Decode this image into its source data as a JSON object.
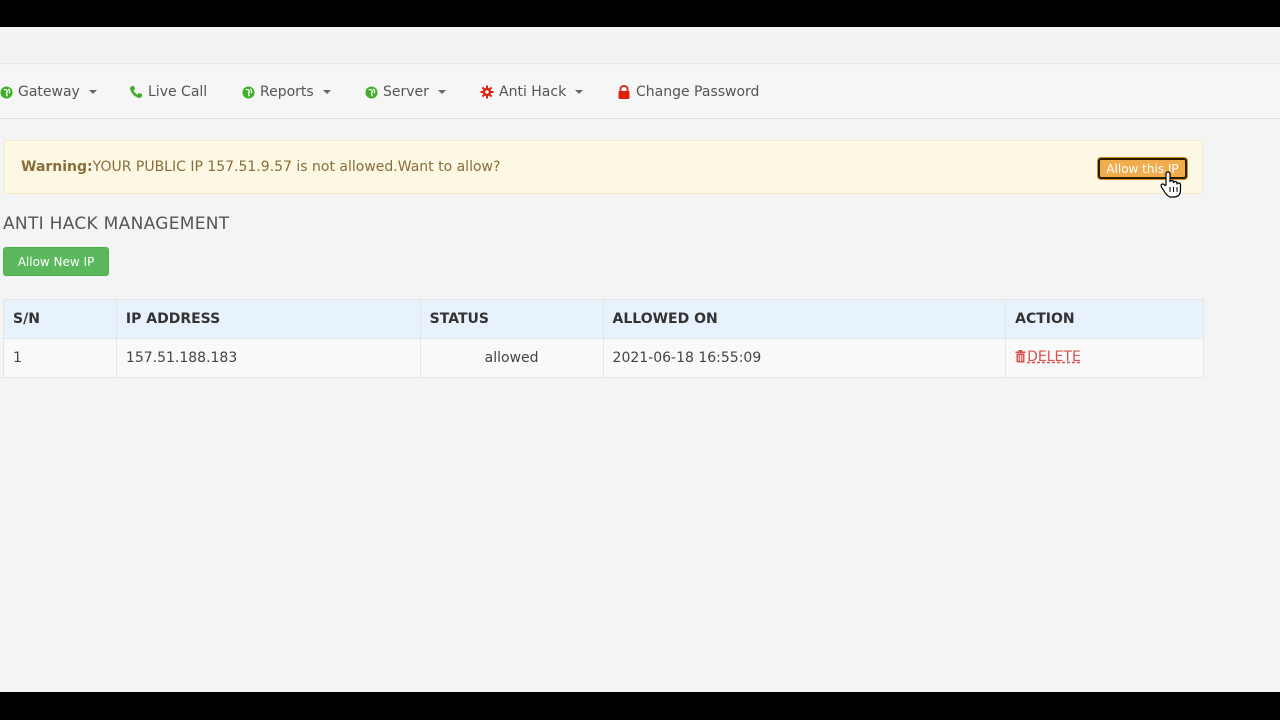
{
  "nav": {
    "items": [
      {
        "label": "Gateway",
        "icon": "globe-icon",
        "dropdown": true
      },
      {
        "label": "Live Call",
        "icon": "phone-icon",
        "dropdown": false
      },
      {
        "label": "Reports",
        "icon": "globe-icon",
        "dropdown": true
      },
      {
        "label": "Server",
        "icon": "globe-icon",
        "dropdown": true
      },
      {
        "label": "Anti Hack",
        "icon": "gear-icon",
        "dropdown": true
      },
      {
        "label": "Change Password",
        "icon": "lock-icon",
        "dropdown": false
      }
    ]
  },
  "alert": {
    "label": "Warning:",
    "message": "YOUR PUBLIC IP 157.51.9.57 is not allowed.Want to allow?",
    "button": "Allow this IP"
  },
  "page": {
    "title": "ANTI HACK MANAGEMENT",
    "allow_new_button": "Allow New IP"
  },
  "table": {
    "headers": [
      "S/N",
      "IP ADDRESS",
      "STATUS",
      "ALLOWED ON",
      "ACTION"
    ],
    "rows": [
      {
        "sn": "1",
        "ip": "157.51.188.183",
        "status": "allowed",
        "allowed_on": "2021-06-18 16:55:09",
        "action": "DELETE"
      }
    ]
  },
  "colors": {
    "nav_green": "#3fae29",
    "nav_red": "#d9230f",
    "alert_bg": "#fcf8e3",
    "alert_text": "#8a6d3b",
    "warning_button": "#f0ad4e",
    "success_button": "#5cb85c",
    "table_header_bg": "#e8f2fc",
    "delete_red": "#d9534f"
  }
}
